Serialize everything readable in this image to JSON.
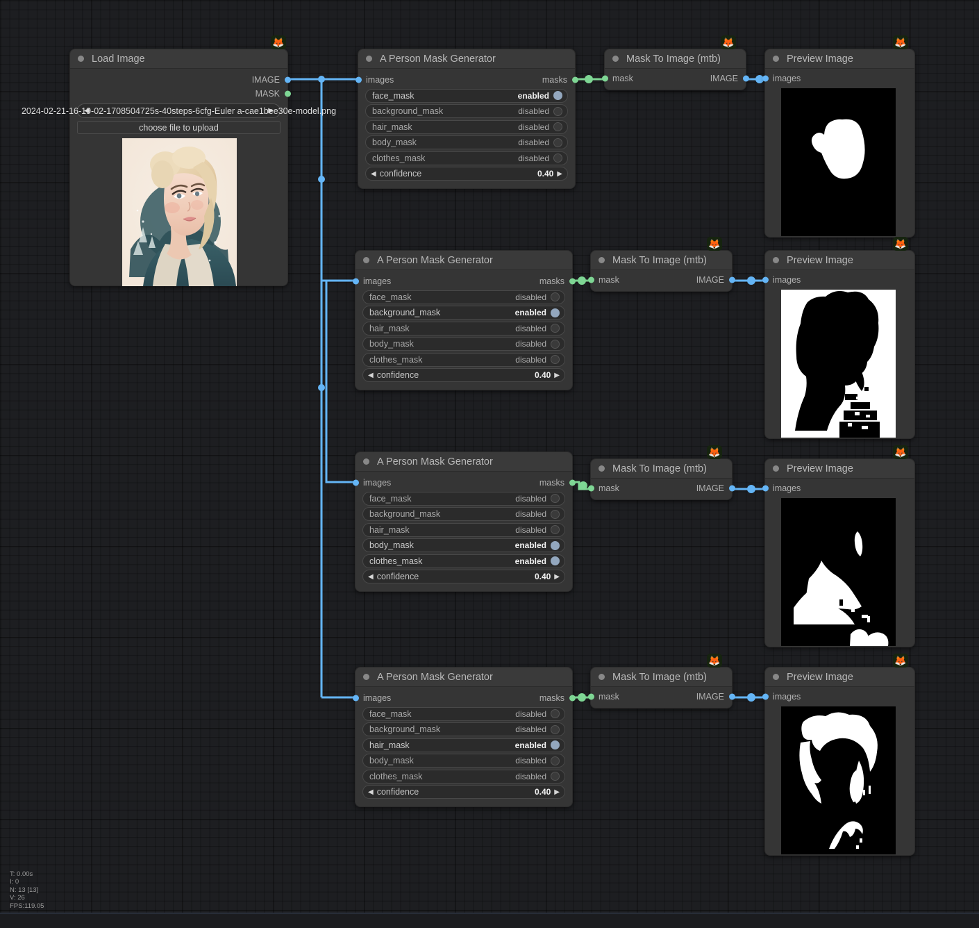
{
  "app": {
    "canvas_bg": "#1d1e21",
    "node_bg": "#353535",
    "image_link_color": "#64b5f6",
    "mask_link_color": "#7ed694",
    "badge_icon": "🦊"
  },
  "stats": {
    "time": "T: 0.00s",
    "iterations": "I: 0",
    "nodes": "N: 13 [13]",
    "vertices": "V: 26",
    "fps": "FPS:119.05"
  },
  "nodes": {
    "load_image": {
      "title": "Load Image",
      "outputs": [
        {
          "label": "IMAGE",
          "type": "image"
        },
        {
          "label": "MASK",
          "type": "mask"
        }
      ],
      "filename": "2024-02-21-16-19-02-1708504725s-40steps-6cfg-Euler a-cae1bee30e-model.png",
      "upload_button": "choose file to upload"
    },
    "mask_gen_titles": "A Person Mask Generator",
    "mask_gen_input": "images",
    "mask_gen_output": "masks",
    "mask_to_image_title": "Mask To Image (mtb)",
    "mask_to_image_input": "mask",
    "mask_to_image_output": "IMAGE",
    "preview_title": "Preview Image",
    "preview_input": "images",
    "generators": [
      {
        "id": "face",
        "widgets": [
          {
            "name": "face_mask",
            "value": "enabled",
            "on": true
          },
          {
            "name": "background_mask",
            "value": "disabled",
            "on": false
          },
          {
            "name": "hair_mask",
            "value": "disabled",
            "on": false
          },
          {
            "name": "body_mask",
            "value": "disabled",
            "on": false
          },
          {
            "name": "clothes_mask",
            "value": "disabled",
            "on": false
          }
        ],
        "confidence_label": "confidence",
        "confidence_value": "0.40"
      },
      {
        "id": "background",
        "widgets": [
          {
            "name": "face_mask",
            "value": "disabled",
            "on": false
          },
          {
            "name": "background_mask",
            "value": "enabled",
            "on": true
          },
          {
            "name": "hair_mask",
            "value": "disabled",
            "on": false
          },
          {
            "name": "body_mask",
            "value": "disabled",
            "on": false
          },
          {
            "name": "clothes_mask",
            "value": "disabled",
            "on": false
          }
        ],
        "confidence_label": "confidence",
        "confidence_value": "0.40"
      },
      {
        "id": "body-clothes",
        "widgets": [
          {
            "name": "face_mask",
            "value": "disabled",
            "on": false
          },
          {
            "name": "background_mask",
            "value": "disabled",
            "on": false
          },
          {
            "name": "hair_mask",
            "value": "disabled",
            "on": false
          },
          {
            "name": "body_mask",
            "value": "enabled",
            "on": true
          },
          {
            "name": "clothes_mask",
            "value": "enabled",
            "on": true
          }
        ],
        "confidence_label": "confidence",
        "confidence_value": "0.40"
      },
      {
        "id": "hair",
        "widgets": [
          {
            "name": "face_mask",
            "value": "disabled",
            "on": false
          },
          {
            "name": "background_mask",
            "value": "disabled",
            "on": false
          },
          {
            "name": "hair_mask",
            "value": "enabled",
            "on": true
          },
          {
            "name": "body_mask",
            "value": "disabled",
            "on": false
          },
          {
            "name": "clothes_mask",
            "value": "disabled",
            "on": false
          }
        ],
        "confidence_label": "confidence",
        "confidence_value": "0.40"
      }
    ]
  }
}
